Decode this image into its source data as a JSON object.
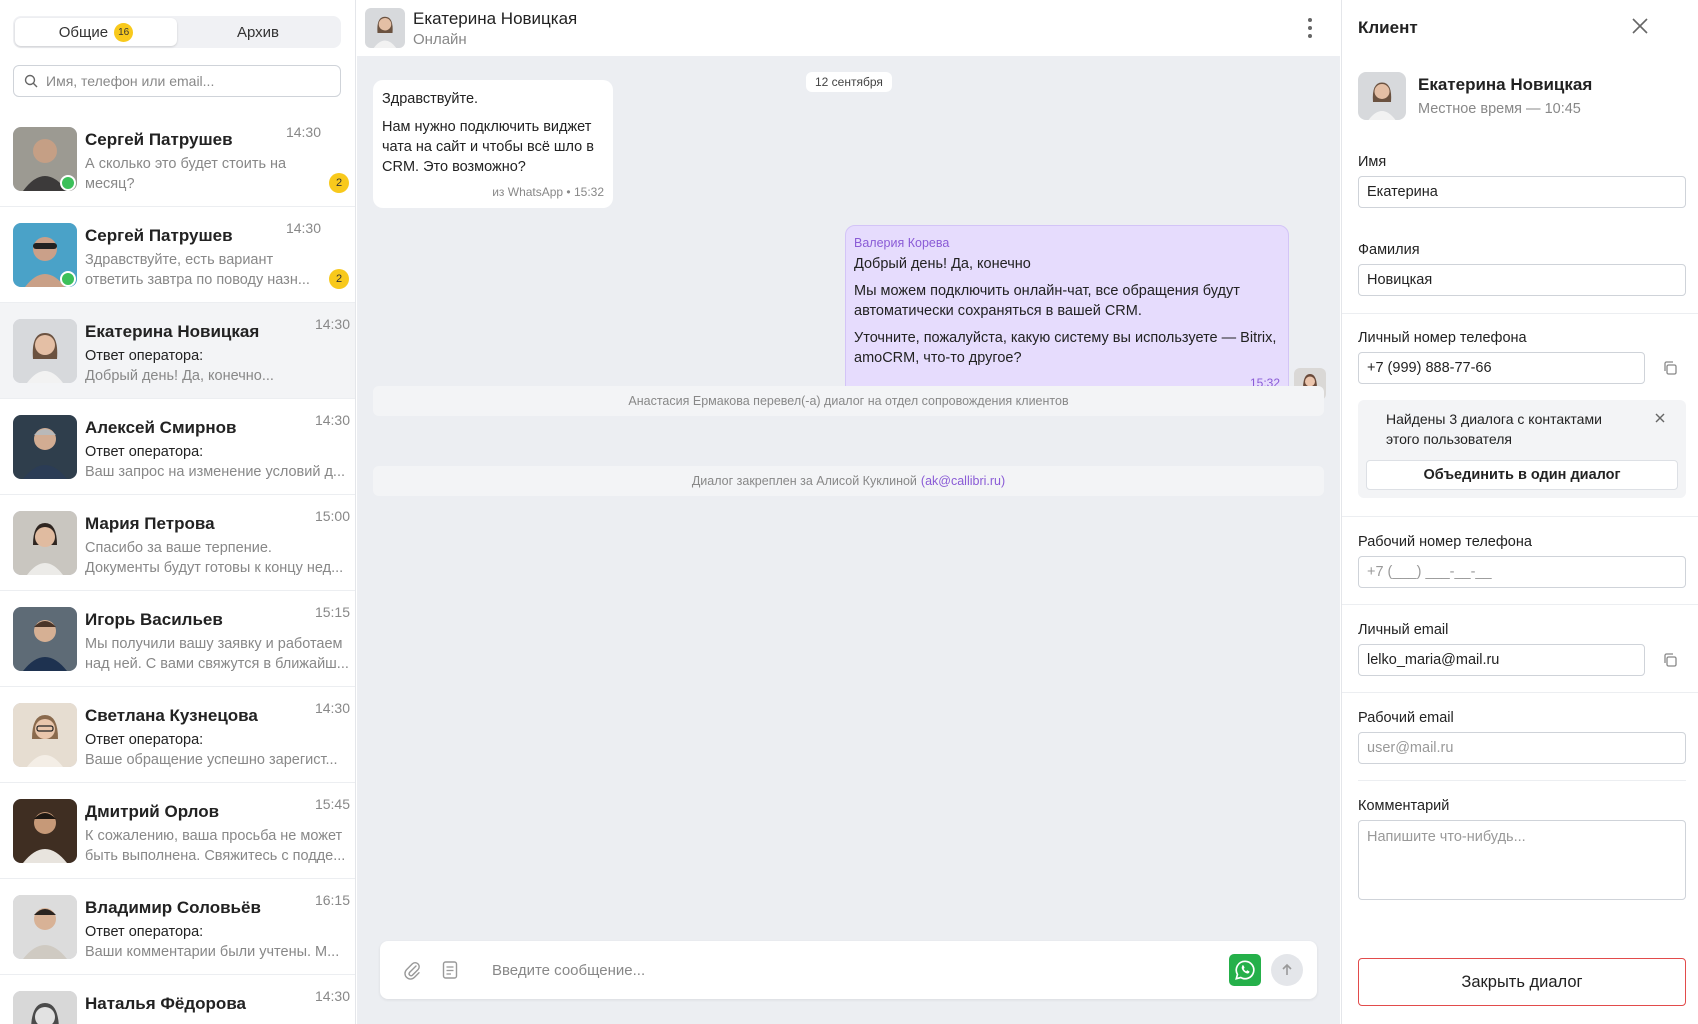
{
  "sidebar": {
    "tabs": [
      {
        "label": "Общие",
        "badge": "16"
      },
      {
        "label": "Архив"
      }
    ],
    "search_placeholder": "Имя, телефон или email...",
    "chats": [
      {
        "name": "Сергей Патрушев",
        "time": "14:30",
        "preview": [
          "А сколько это будет стоить на",
          "месяц?"
        ],
        "unread": "2",
        "online": true
      },
      {
        "name": "Сергей Патрушев",
        "time": "14:30",
        "preview": [
          "Здравствуйте, есть вариант",
          "ответить завтра по поводу назн..."
        ],
        "unread": "2",
        "online": true
      },
      {
        "name": "Екатерина Новицкая",
        "time": "14:30",
        "operator": "Ответ оператора:",
        "preview": [
          "Добрый день! Да, конечно..."
        ],
        "active": true
      },
      {
        "name": "Алексей Смирнов",
        "time": "14:30",
        "operator": "Ответ оператора:",
        "preview": [
          "Ваш запрос на изменение условий д..."
        ]
      },
      {
        "name": "Мария Петрова",
        "time": "15:00",
        "preview": [
          "Спасибо за ваше терпение.",
          "Документы будут готовы к концу нед..."
        ]
      },
      {
        "name": "Игорь Васильев",
        "time": "15:15",
        "preview": [
          "Мы получили вашу заявку и работаем",
          "над ней. С вами свяжутся в ближайш..."
        ]
      },
      {
        "name": "Светлана Кузнецова",
        "time": "14:30",
        "operator": "Ответ оператора:",
        "preview": [
          "Ваше обращение успешно зарегист..."
        ]
      },
      {
        "name": "Дмитрий Орлов",
        "time": "15:45",
        "preview": [
          "К сожалению, ваша просьба не может",
          "быть выполнена. Свяжитесь с подде..."
        ]
      },
      {
        "name": "Владимир Соловьёв",
        "time": "16:15",
        "operator": "Ответ оператора:",
        "preview": [
          "Ваши комментарии были учтены. М..."
        ]
      },
      {
        "name": "Наталья Фёдорова",
        "time": "14:30",
        "preview": []
      }
    ]
  },
  "header": {
    "name": "Екатерина Новицкая",
    "status": "Онлайн"
  },
  "conversation": {
    "date": "12 сентября",
    "incoming": {
      "lines": [
        "Здравствуйте.",
        "Нам нужно подключить виджет чата на сайт и чтобы всё шло в CRM. Это возможно?"
      ],
      "meta": "из WhatsApp • 15:32"
    },
    "outgoing": {
      "sender": "Валерия Корева",
      "lines": [
        "Добрый день! Да, конечно",
        "Мы можем подключить онлайн-чат, все обращения будут автоматически сохраняться в вашей CRM.",
        "Уточните, пожалуйста, какую систему вы используете — Bitrix, amoCRM, что-то другое?"
      ],
      "time": "15:32"
    },
    "system": [
      {
        "text": "Анастасия Ермакова перевел(-а) диалог на отдел сопровождения клиентов"
      },
      {
        "text": "Диалог закреплен за Алисой Куклиной",
        "link": "(ak@callibri.ru)"
      }
    ]
  },
  "composer": {
    "placeholder": "Введите сообщение..."
  },
  "client_panel": {
    "title": "Клиент",
    "name": "Екатерина Новицкая",
    "local_time": "Местное время — 10:45",
    "first_name_label": "Имя",
    "first_name": "Екатерина",
    "last_name_label": "Фамилия",
    "last_name": "Новицкая",
    "personal_phone_label": "Личный номер телефона",
    "personal_phone": "+7 (999) 888-77-66",
    "notice": "Найдены 3 диалога с контактами этого пользователя",
    "merge_label": "Объединить в один диалог",
    "work_phone_label": "Рабочий номер телефона",
    "work_phone_placeholder": "+7 (___) ___-__-__",
    "personal_email_label": "Личный email",
    "personal_email": "lelko_maria@mail.ru",
    "work_email_label": "Рабочий email",
    "work_email_placeholder": "user@mail.ru",
    "comment_label": "Комментарий",
    "comment_placeholder": "Напишите что-нибудь...",
    "close_label": "Закрыть диалог"
  },
  "colors": {
    "accent": "#8a5bd6",
    "outgoing_bubble": "#e6dcfd",
    "badge": "#f8c91c",
    "online": "#3cc05a",
    "whatsapp": "#25b04a",
    "danger": "#e24b4b"
  }
}
